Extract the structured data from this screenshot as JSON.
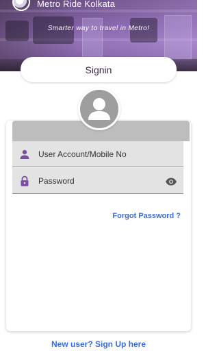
{
  "app": {
    "title": "Metro Ride Kolkata",
    "tagline": "Smarter way to travel in Metro!"
  },
  "signin_tab": {
    "label": "Signin"
  },
  "form": {
    "account_field": {
      "placeholder": "User Account/Mobile No",
      "icon": "person-icon"
    },
    "password_field": {
      "placeholder": "Password",
      "icon": "lock-icon",
      "toggle_icon": "eye-icon"
    }
  },
  "links": {
    "forgot_password": "Forgot Password ?",
    "signup": "New user? Sign Up here"
  },
  "colors": {
    "accent": "#7b4fa0",
    "link": "#3a6fd8",
    "field_bg": "#e3e3e3",
    "header_bar": "#bdbdbd"
  }
}
